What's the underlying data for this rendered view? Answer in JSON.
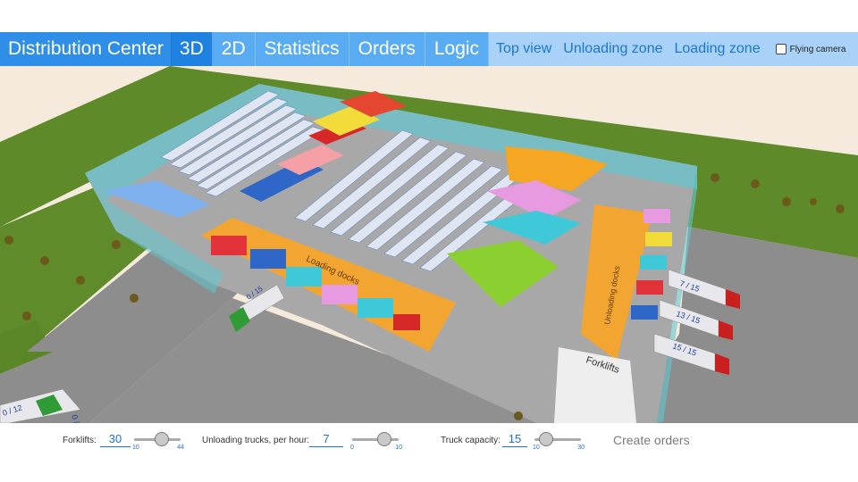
{
  "header": {
    "title": "Distribution Center",
    "tabs": [
      "3D",
      "2D",
      "Statistics",
      "Orders",
      "Logic"
    ],
    "active_tab": "3D",
    "view_links": [
      "Top view",
      "Unloading zone",
      "Loading zone"
    ],
    "flying_camera_label": "Flying camera"
  },
  "scene": {
    "loading_docks_label": "Loading docks",
    "unloading_docks_label": "Unloading docks",
    "forklifts_label": "Forklifts",
    "truck_labels": [
      "7 / 15",
      "13 / 15",
      "15 / 15",
      "0 / 15",
      "0 / 12",
      "0 /"
    ],
    "colors": {
      "floor": "#a8a8a8",
      "grass": "#5e8a2a",
      "outer_ground": "#f4e6d8",
      "road": "#8d8d8d",
      "building_glass": "#6ad0d8",
      "loading_zone": "#f3a531",
      "unloading_zone": "#f3a531"
    }
  },
  "controls": {
    "forklifts": {
      "label": "Forklifts:",
      "value": "30",
      "min": "10",
      "max": "44"
    },
    "unloading": {
      "label": "Unloading trucks, per hour:",
      "value": "7",
      "min": "0",
      "max": "10"
    },
    "capacity": {
      "label": "Truck capacity:",
      "value": "15",
      "min": "10",
      "max": "30"
    },
    "create_orders_label": "Create orders"
  }
}
